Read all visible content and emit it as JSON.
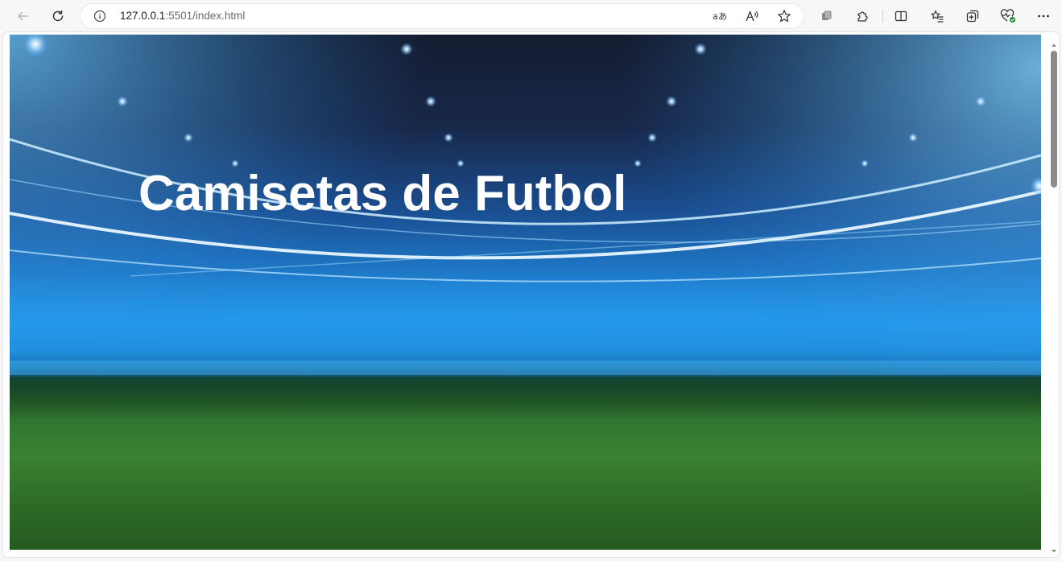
{
  "browser": {
    "url_host": "127.0.0.1",
    "url_path": ":5501/index.html",
    "icons": {
      "back": "back-arrow-icon",
      "refresh": "refresh-icon",
      "site_info": "info-icon",
      "translate": "translate-icon",
      "read_aloud": "read-aloud-icon",
      "favorite": "star-icon",
      "workspaces": "workspaces-icon",
      "extensions": "puzzle-icon",
      "split_screen": "split-screen-icon",
      "favorites_list": "favorites-list-icon",
      "collections": "collections-icon",
      "performance": "heartbeat-icon",
      "more": "more-icon"
    }
  },
  "page": {
    "hero_title": "Camisetas de Futbol"
  },
  "colors": {
    "title": "#ffffff",
    "sky_dark": "#151c30",
    "beam_blue": "#1f7fd0",
    "grass_green": "#3f8a34"
  }
}
